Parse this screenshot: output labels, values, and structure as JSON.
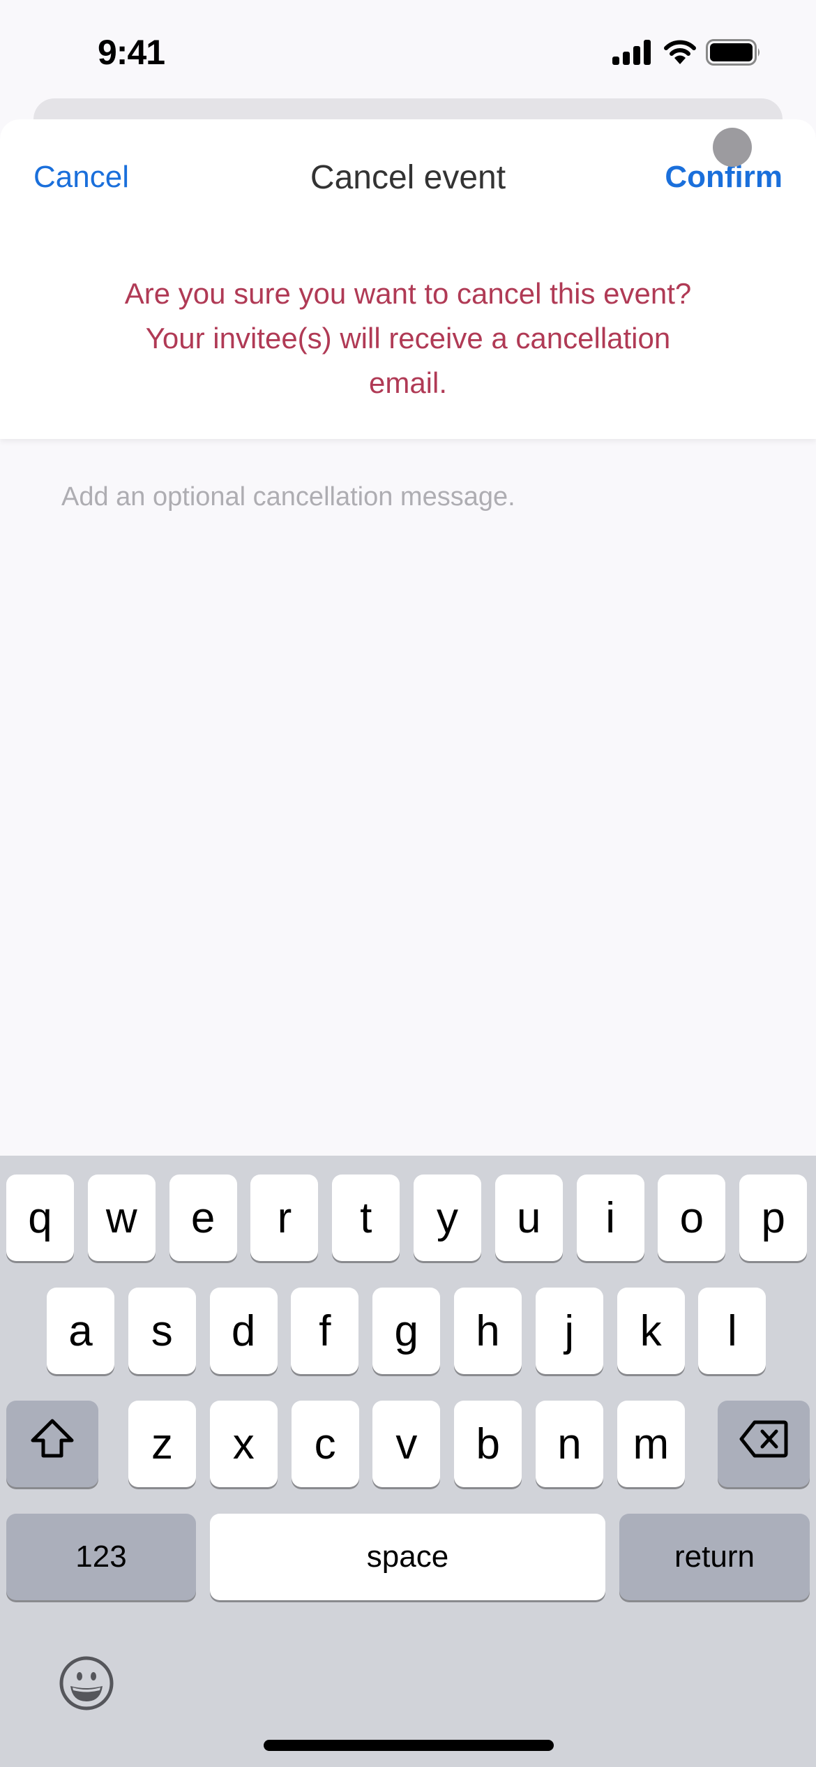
{
  "status_bar": {
    "time": "9:41",
    "icons": [
      "cellular-signal-icon",
      "wifi-icon",
      "battery-icon"
    ]
  },
  "sheet": {
    "cancel_label": "Cancel",
    "title": "Cancel event",
    "confirm_label": "Confirm",
    "warning": "Are you sure you want to cancel this event? Your invitee(s) will receive a cancellation email.",
    "message_input": {
      "value": "",
      "placeholder": "Add an optional cancellation message."
    }
  },
  "colors": {
    "accent": "#1a6fdb",
    "warning": "#b03a55",
    "title": "#333333",
    "placeholder": "#aeadb2",
    "keyboard_bg": "#d1d3d9"
  },
  "keyboard": {
    "row1": [
      "q",
      "w",
      "e",
      "r",
      "t",
      "y",
      "u",
      "i",
      "o",
      "p"
    ],
    "row2": [
      "a",
      "s",
      "d",
      "f",
      "g",
      "h",
      "j",
      "k",
      "l"
    ],
    "row3": [
      "z",
      "x",
      "c",
      "v",
      "b",
      "n",
      "m"
    ],
    "shift_icon": "shift-arrow-icon",
    "delete_icon": "delete-backspace-icon",
    "numbers_label": "123",
    "space_label": "space",
    "return_label": "return",
    "emoji_icon": "emoji-smiley-icon"
  }
}
